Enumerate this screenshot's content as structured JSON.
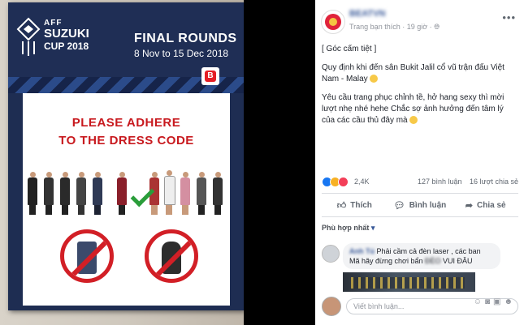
{
  "photo": {
    "logo": {
      "aff": "AFF",
      "suzuki": "SUZUKI",
      "cup": "CUP 2018"
    },
    "event_title": "FINAL ROUNDS",
    "event_dates": "8 Nov to 15 Dec 2018",
    "sign_line1": "PLEASE ADHERE",
    "sign_line2": "TO THE DRESS CODE"
  },
  "post": {
    "author": "BEATVN",
    "meta_like": "Trang bạn thích",
    "meta_time": "19 giờ",
    "body": [
      "[ Góc cấm tiệt ]",
      "Quy định khi đến sân Bukit Jalil cổ vũ trận đấu Việt Nam - Malay",
      "Yêu cầu trang phục chỉnh tề, hở hang sexy thì mời lượt nhẹ nhé hehe  Chắc sợ ảnh hưởng đến tâm lý của các cầu thủ đây mà"
    ],
    "reactions_count": "2,4K",
    "comments_count": "127 bình luận",
    "shares_count": "16 lượt chia sẻ",
    "actions": {
      "like": "Thích",
      "comment": "Bình luận",
      "share": "Chia sẻ"
    },
    "relevance": "Phù hợp nhất",
    "comment": {
      "author": "Anh Tú",
      "text1": "Phải cầm cả đèn laser , các ban",
      "text2a": "Mã hãy đừng chơi bẩn",
      "text2b_blurred": "ĐÈO",
      "text2c": "VUI ĐÂU"
    },
    "write_placeholder": "Viết bình luận...",
    "colors": {
      "link": "#385898",
      "like": "#1877f2",
      "heart": "#f33e58",
      "haha": "#f7b125"
    }
  }
}
